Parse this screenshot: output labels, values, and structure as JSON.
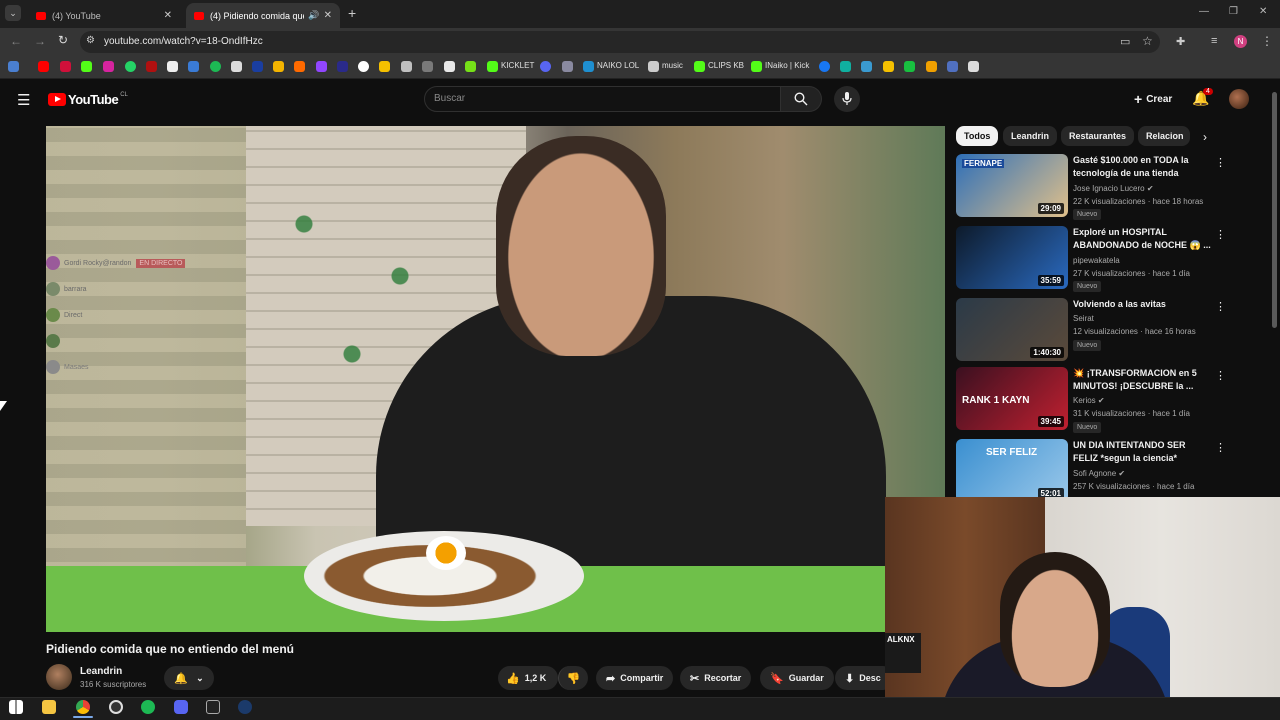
{
  "browser": {
    "tabs": [
      {
        "title": "(4) YouTube",
        "active": false
      },
      {
        "title": "(4) Pidiendo comida que no e",
        "active": true
      }
    ],
    "url": "youtube.com/watch?v=18-OndIfHzc",
    "bookmarks": [
      "KICKLET",
      "NAIKO LOL",
      "music",
      "CLIPS KB",
      "INaiko | Kick"
    ]
  },
  "youtube": {
    "logo": "YouTube",
    "country": "CL",
    "search_placeholder": "Buscar",
    "create_label": "Crear",
    "notif_count": "4"
  },
  "video": {
    "title": "Pidiendo comida que no entiendo del menú",
    "overlay_chat": [
      {
        "name": "Gordi Rocky@randon",
        "tag": "EN DIRECTO"
      },
      {
        "name": "barrara"
      },
      {
        "name": "Direct"
      },
      {
        "name": ""
      },
      {
        "name": "Masaes"
      }
    ],
    "channel": {
      "name": "Leandrin",
      "subs": "316 K suscriptores"
    },
    "actions": {
      "likes": "1,2 K",
      "share": "Compartir",
      "clip": "Recortar",
      "save": "Guardar",
      "download": "Desc"
    }
  },
  "chips": [
    "Todos",
    "Leandrin",
    "Restaurantes",
    "Relacion"
  ],
  "recommendations": [
    {
      "title": "Gasté $100.000 en TODA la tecnología de una tienda china...",
      "channel": "Jose Ignacio Lucero",
      "verified": true,
      "meta": "22 K visualizaciones · hace 18 horas",
      "badge": "Nuevo",
      "duration": "29:09",
      "thumb_text": "FERNAPE",
      "colors": [
        "#2e6fb8",
        "#e0c08a"
      ]
    },
    {
      "title": "Exploré un HOSPITAL ABANDONADO de NOCHE 😱 ...",
      "channel": "pipewakatela",
      "verified": false,
      "meta": "27 K visualizaciones · hace 1 día",
      "badge": "Nuevo",
      "duration": "35:59",
      "thumb_text": "",
      "colors": [
        "#0d1a2a",
        "#2a6ac0"
      ]
    },
    {
      "title": "Volviendo a las avitas",
      "channel": "Seirat",
      "verified": false,
      "meta": "12 visualizaciones · hace 16 horas",
      "badge": "Nuevo",
      "duration": "1:40:30",
      "thumb_text": "",
      "colors": [
        "#2b3a48",
        "#5b4a3a"
      ]
    },
    {
      "title": "💥 ¡TRANSFORMACION en 5 MINUTOS! ¡DESCUBRE la ...",
      "channel": "Kerios",
      "verified": true,
      "meta": "31 K visualizaciones · hace 1 día",
      "badge": "Nuevo",
      "duration": "39:45",
      "thumb_text": "RANK 1 KAYN",
      "colors": [
        "#3a1020",
        "#c02030"
      ]
    },
    {
      "title": "UN DIA INTENTANDO SER FELIZ *segun la ciencia*",
      "channel": "Sofi Agnone",
      "verified": true,
      "meta": "257 K visualizaciones · hace 1 día",
      "badge": "",
      "duration": "52:01",
      "thumb_text": "SER FELIZ",
      "colors": [
        "#3a8fd0",
        "#9ac8ea"
      ]
    }
  ],
  "webcam_text": "ALKNX",
  "colors": {
    "accent": "#ff0000",
    "bg": "#0f0f0f",
    "chip": "#272727",
    "text_secondary": "#aaaaaa"
  }
}
